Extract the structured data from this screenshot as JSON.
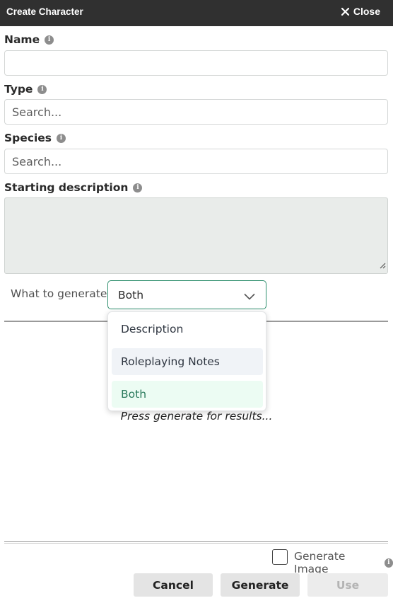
{
  "window": {
    "title": "Create Character",
    "close_label": "Close"
  },
  "form": {
    "name": {
      "label": "Name",
      "value": ""
    },
    "type": {
      "label": "Type",
      "placeholder": "Search..."
    },
    "species": {
      "label": "Species",
      "placeholder": "Search..."
    },
    "description": {
      "label": "Starting description",
      "value": ""
    }
  },
  "generate": {
    "label": "What to generate:",
    "selected": "Both",
    "options": [
      "Description",
      "Roleplaying Notes",
      "Both"
    ],
    "hovered_option": "Roleplaying Notes"
  },
  "results": {
    "placeholder": "Press generate for results..."
  },
  "footer": {
    "generate_image_label": "Generate Image",
    "generate_image_checked": false,
    "cancel_label": "Cancel",
    "generate_label": "Generate",
    "use_label": "Use"
  },
  "colors": {
    "titlebar": "#303030",
    "accent": "#2e8f6d",
    "selected_option_bg": "#ecfcf3",
    "hover_option_bg": "#f0f3f7"
  }
}
